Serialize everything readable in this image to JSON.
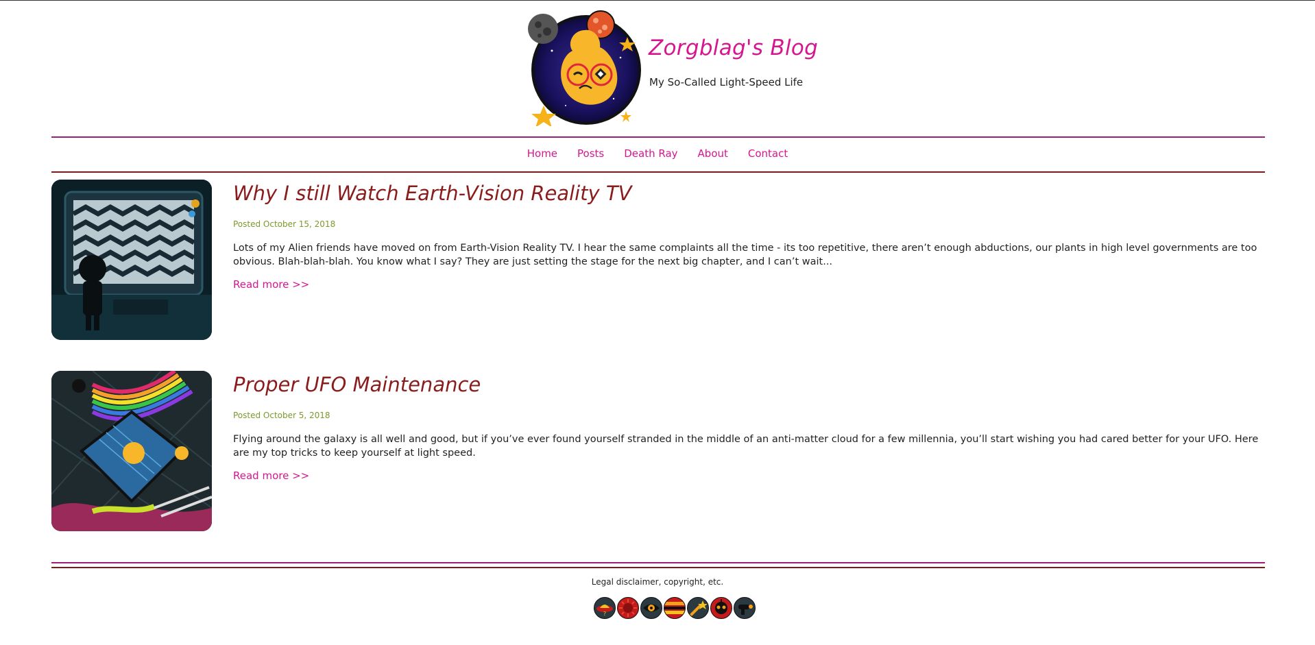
{
  "site": {
    "title": "Zorgblag's Blog",
    "tagline": "My So-Called Light-Speed Life"
  },
  "nav": {
    "items": [
      "Home",
      "Posts",
      "Death Ray",
      "About",
      "Contact"
    ]
  },
  "posts": [
    {
      "title": "Why I still Watch Earth-Vision Reality TV",
      "date": "Posted October 15, 2018",
      "excerpt": "Lots of my Alien friends have moved on from Earth-Vision Reality TV. I hear the same complaints all the time - its too repetitive, there aren’t enough abductions, our plants in high level governments are too obvious. Blah-blah-blah. You know what I say? They are just setting the stage for the next big chapter, and I can’t wait...",
      "read_more": "Read more >>"
    },
    {
      "title": "Proper UFO Maintenance",
      "date": "Posted October 5, 2018",
      "excerpt": "Flying around the galaxy is all well and good, but if you’ve ever found yourself stranded in the middle of an anti-matter cloud for a few millennia, you’ll start wishing you had cared better for your UFO. Here are my top tricks to keep yourself at light speed.",
      "read_more": "Read more >>"
    }
  ],
  "footer": {
    "legal": "Legal disclaimer, copyright, etc.",
    "social_icons": [
      "ufo-icon",
      "sun-icon",
      "eye-icon",
      "planet-icon",
      "comet-icon",
      "alien-icon",
      "raygun-icon"
    ]
  },
  "colors": {
    "accent": "#d6168f",
    "title": "#8a1c1c",
    "date": "#7a9a2a",
    "rule_purple": "#9c1f78",
    "rule_red": "#7a1a1a"
  }
}
